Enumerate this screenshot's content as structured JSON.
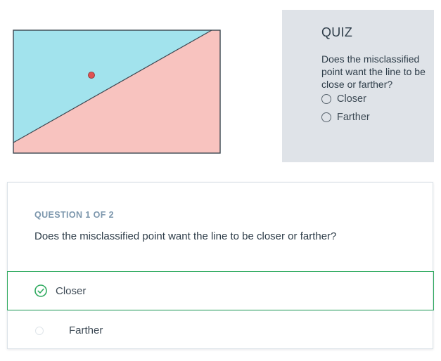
{
  "illustration": {
    "colors": {
      "upper_region": "#a2e3ed",
      "lower_region": "#f8c3bf",
      "border": "#3c4650",
      "point": "#e05252"
    },
    "icons": [
      "misclassified-point"
    ]
  },
  "side_quiz": {
    "title": "QUIZ",
    "question": "Does the misclassified point want the line to be close or farther?",
    "options": [
      {
        "label": "Closer"
      },
      {
        "label": "Farther"
      }
    ]
  },
  "question_card": {
    "counter": "QUESTION 1 OF 2",
    "question": "Does the misclassified point want the line to be closer or farther?",
    "options": [
      {
        "label": "Closer",
        "selected": true
      },
      {
        "label": "Farther",
        "selected": false
      }
    ],
    "colors": {
      "selected_border": "#2faa5f",
      "check": "#2faa5f"
    }
  }
}
